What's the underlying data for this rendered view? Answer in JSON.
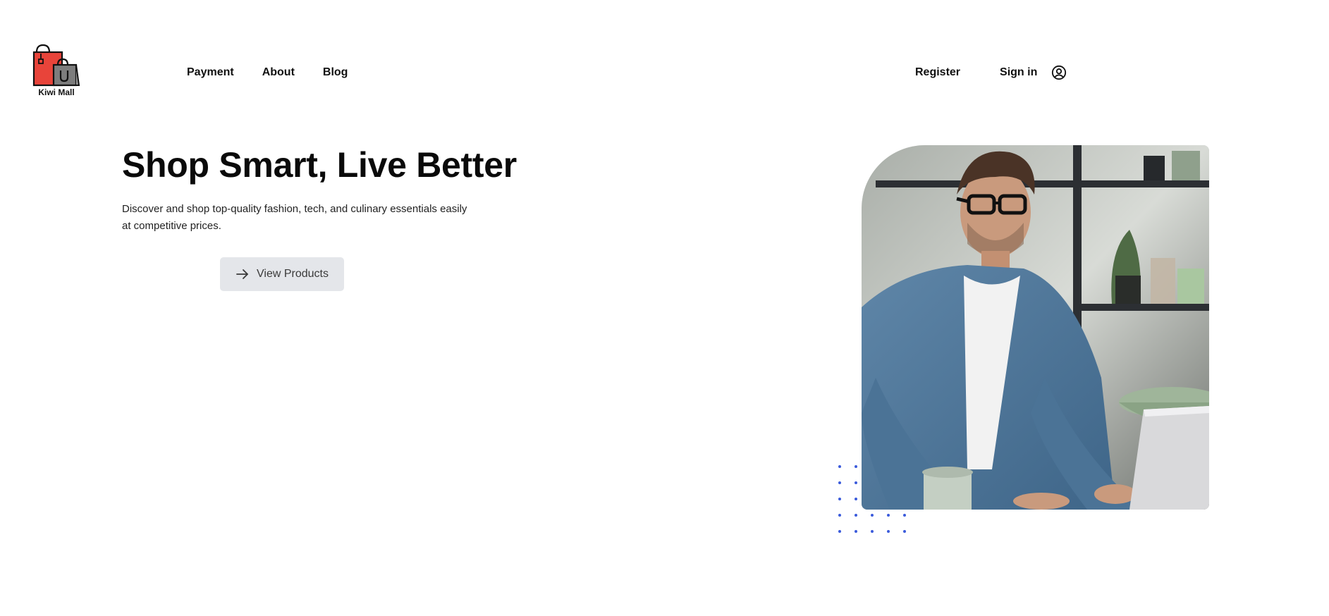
{
  "brand": {
    "name": "Kiwi Mall",
    "logo_icon": "shopping-bags-icon"
  },
  "nav": {
    "items": [
      "Payment",
      "About",
      "Blog"
    ]
  },
  "auth": {
    "register": "Register",
    "signin": "Sign in",
    "user_icon": "user-circle-icon"
  },
  "hero": {
    "title": "Shop Smart, Live Better",
    "description": "Discover and shop top-quality fashion, tech, and culinary essentials easily at competitive prices.",
    "cta_label": "View Products",
    "cta_icon": "arrow-right-icon"
  },
  "image": {
    "subject": "man-with-glasses-using-laptop"
  },
  "colors": {
    "dot_accent": "#3b5bdb",
    "cta_bg": "#e4e6ea",
    "bag_red": "#e8443a",
    "bag_gray": "#7d7d7d"
  }
}
